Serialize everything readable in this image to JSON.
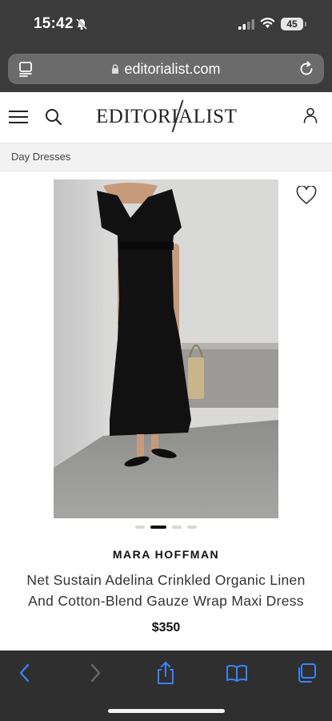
{
  "status_bar": {
    "time": "15:42",
    "battery": "45",
    "icons": [
      "bell-slash-icon",
      "cellular-signal-icon",
      "wifi-icon",
      "battery-icon"
    ]
  },
  "address_bar": {
    "url": "editorialist.com",
    "icons": [
      "reader-view-icon",
      "lock-icon",
      "reload-icon"
    ]
  },
  "header": {
    "logo": "EDITORIALIST",
    "icons": [
      "hamburger-menu-icon",
      "search-icon",
      "account-icon"
    ]
  },
  "breadcrumb": "Day Dresses",
  "product": {
    "brand": "MARA HOFFMAN",
    "title_line1": "Net Sustain Adelina Crinkled Organic Linen",
    "title_line2": "And Cotton-Blend Gauze Wrap Maxi Dress",
    "price": "$350",
    "image_count": 4,
    "active_image": 2,
    "wishlist_icon": "heart-icon"
  },
  "toolbar": {
    "icons": [
      "back-icon",
      "forward-icon",
      "share-icon",
      "bookmarks-icon",
      "tabs-icon"
    ]
  },
  "colors": {
    "chrome": "#3b3b3b",
    "safari_blue": "#3b82f6",
    "dress": "#111111"
  }
}
